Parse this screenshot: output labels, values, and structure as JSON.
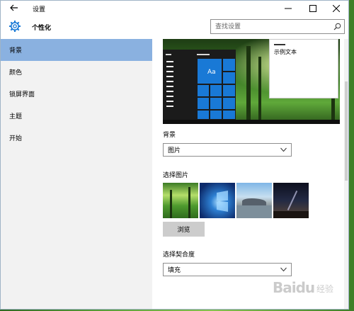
{
  "window": {
    "title": "设置"
  },
  "header": {
    "title": "个性化",
    "search_placeholder": "查找设置"
  },
  "sidebar": {
    "items": [
      {
        "label": "背景",
        "selected": true
      },
      {
        "label": "颜色",
        "selected": false
      },
      {
        "label": "锁屏界面",
        "selected": false
      },
      {
        "label": "主题",
        "selected": false
      },
      {
        "label": "开始",
        "selected": false
      }
    ]
  },
  "preview": {
    "tile_label": "Aa",
    "sample_text": "示例文本"
  },
  "background": {
    "label": "背景",
    "selected_value": "图片"
  },
  "choose_picture": {
    "label": "选择图片",
    "browse_label": "浏览"
  },
  "fit": {
    "label": "选择契合度",
    "selected_value": "填充"
  },
  "watermark": {
    "text": "Baidu",
    "sub": "经验"
  },
  "colors": {
    "accent": "#1979d6",
    "selection": "#8ab1e0"
  }
}
